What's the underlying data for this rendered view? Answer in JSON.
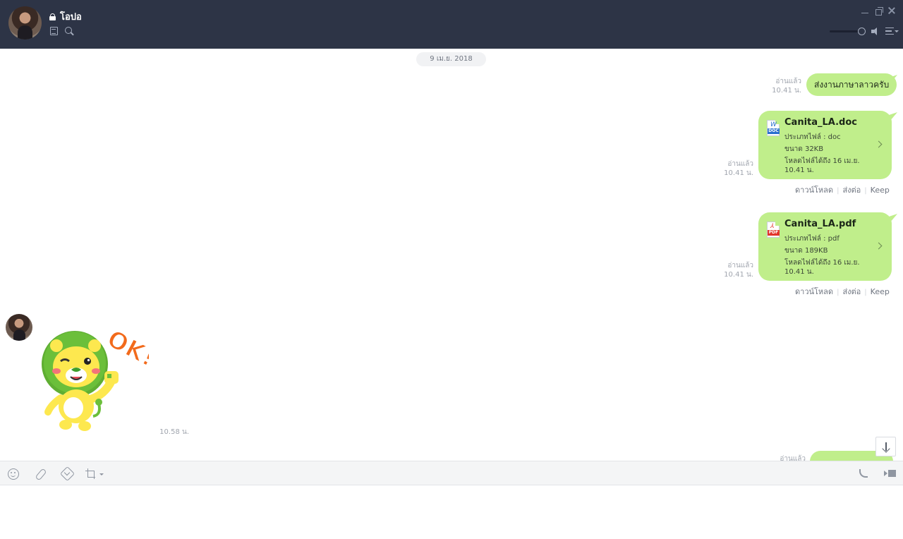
{
  "header": {
    "chat_name": "โอปอ",
    "icons": [
      "lock-icon",
      "notes-icon",
      "search-icon",
      "minimize-icon",
      "restore-icon",
      "close-icon",
      "volume-slider",
      "speaker-icon",
      "menu-icon"
    ],
    "volume_level": 0.85
  },
  "chat": {
    "date_separator": "9 เม.ย. 2018",
    "messages": [
      {
        "kind": "text",
        "direction": "outgoing",
        "text": "ส่งงานภาษาลาวครับ",
        "read_label": "อ่านแล้ว",
        "time": "10.41 น."
      },
      {
        "kind": "file",
        "direction": "outgoing",
        "file_name": "Canita_LA.doc",
        "file_type": "ประเภทไฟล์ : doc",
        "file_size": "ขนาด 32KB",
        "expires_line1": "โหลดไฟล์ได้ถึง 16 เม.ย.",
        "expires_line2": "10.41 น.",
        "icon_tag": "DOC",
        "icon_glyph": "W",
        "read_label": "อ่านแล้ว",
        "time": "10.41 น.",
        "actions": [
          "ดาวน์โหลด",
          "ส่งต่อ",
          "Keep"
        ]
      },
      {
        "kind": "file",
        "direction": "outgoing",
        "file_name": "Canita_LA.pdf",
        "file_type": "ประเภทไฟล์ : pdf",
        "file_size": "ขนาด 189KB",
        "expires_line1": "โหลดไฟล์ได้ถึง 16 เม.ย.",
        "expires_line2": "10.41 น.",
        "icon_tag": "PDF",
        "icon_glyph": "⅄",
        "read_label": "อ่านแล้ว",
        "time": "10.41 น.",
        "actions": [
          "ดาวน์โหลด",
          "ส่งต่อ",
          "Keep"
        ]
      },
      {
        "kind": "sticker",
        "direction": "incoming",
        "sticker_text": "OK!",
        "time": "10.58 น."
      },
      {
        "kind": "text",
        "direction": "outgoing",
        "read_label": "อ่านแล้ว",
        "partial": true
      }
    ]
  },
  "colors": {
    "titlebar": "#2d3446",
    "bubble": "#c0ee8b",
    "doc_tag": "#2a6fcf",
    "pdf_tag": "#e2342b",
    "sticker_ok": "#f26a1b",
    "lion_mane": "#6bbf3a",
    "lion_face": "#fde84f"
  },
  "toolbar": {
    "icons": [
      "emoji-icon",
      "attach-icon",
      "keep-icon",
      "screenshot-icon",
      "call-icon",
      "video-call-icon"
    ]
  },
  "input": {
    "value": ""
  }
}
